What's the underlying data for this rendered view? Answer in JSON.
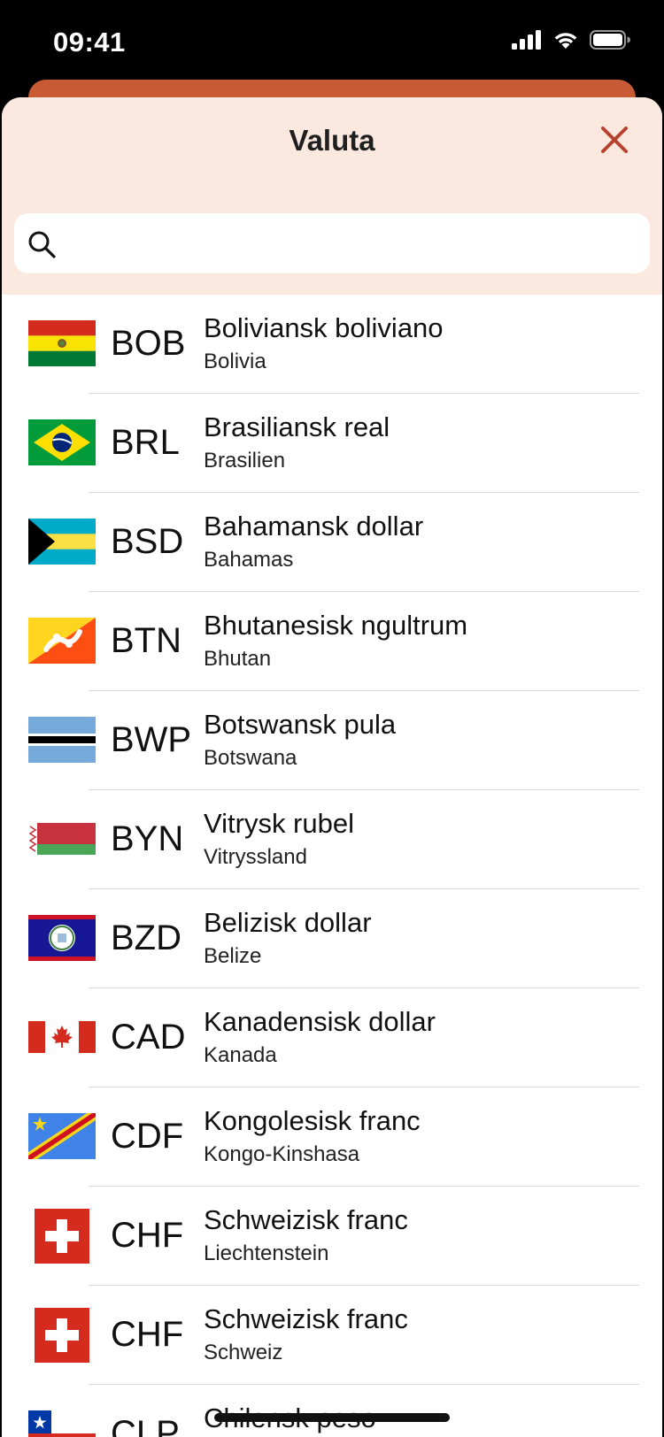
{
  "status_bar": {
    "time": "09:41",
    "icons": [
      "cellular-signal-icon",
      "wifi-icon",
      "battery-icon"
    ]
  },
  "modal": {
    "title": "Valuta",
    "close_icon": "close-icon",
    "search": {
      "icon": "search-icon",
      "value": "",
      "placeholder": ""
    }
  },
  "colors": {
    "accent": "#b5432f",
    "header_bg": "#fbe9df",
    "background_sheet": "#c85a35"
  },
  "currencies": [
    {
      "code": "BOB",
      "name": "Boliviansk boliviano",
      "country": "Bolivia",
      "flag": "bolivia-flag-icon"
    },
    {
      "code": "BRL",
      "name": "Brasiliansk real",
      "country": "Brasilien",
      "flag": "brazil-flag-icon"
    },
    {
      "code": "BSD",
      "name": "Bahamansk dollar",
      "country": "Bahamas",
      "flag": "bahamas-flag-icon"
    },
    {
      "code": "BTN",
      "name": "Bhutanesisk ngultrum",
      "country": "Bhutan",
      "flag": "bhutan-flag-icon"
    },
    {
      "code": "BWP",
      "name": "Botswansk pula",
      "country": "Botswana",
      "flag": "botswana-flag-icon"
    },
    {
      "code": "BYN",
      "name": "Vitrysk rubel",
      "country": "Vitryssland",
      "flag": "belarus-flag-icon"
    },
    {
      "code": "BZD",
      "name": "Belizisk dollar",
      "country": "Belize",
      "flag": "belize-flag-icon"
    },
    {
      "code": "CAD",
      "name": "Kanadensisk dollar",
      "country": "Kanada",
      "flag": "canada-flag-icon"
    },
    {
      "code": "CDF",
      "name": "Kongolesisk franc",
      "country": "Kongo-Kinshasa",
      "flag": "dr-congo-flag-icon"
    },
    {
      "code": "CHF",
      "name": "Schweizisk franc",
      "country": "Liechtenstein",
      "flag": "switzerland-flag-icon"
    },
    {
      "code": "CHF",
      "name": "Schweizisk franc",
      "country": "Schweiz",
      "flag": "switzerland-flag-icon"
    },
    {
      "code": "CLP",
      "name": "Chilensk peso",
      "country": "",
      "flag": "chile-flag-icon"
    }
  ]
}
